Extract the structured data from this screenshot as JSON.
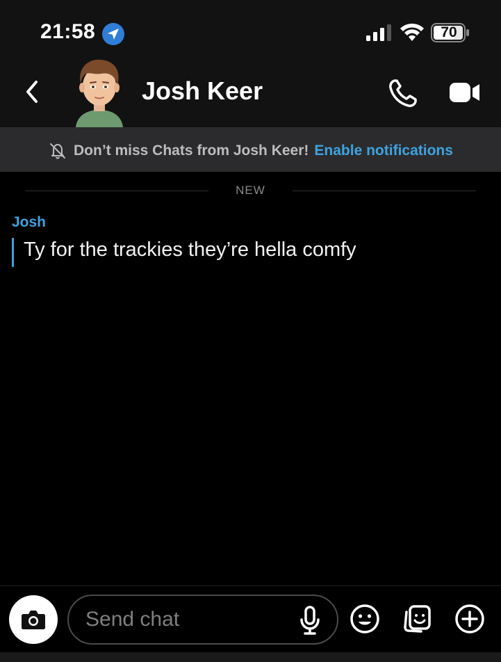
{
  "status_bar": {
    "time": "21:58",
    "battery": "70"
  },
  "header": {
    "contact_name": "Josh Keer",
    "icons": [
      "back-icon",
      "call-icon",
      "video-icon"
    ]
  },
  "notification_banner": {
    "text": "Don’t miss Chats from Josh Keer!",
    "link": "Enable notifications"
  },
  "conversation": {
    "divider_label": "NEW",
    "messages": [
      {
        "sender": "Josh",
        "text": "Ty for the trackies they’re hella comfy"
      }
    ]
  },
  "composer": {
    "placeholder": "Send chat",
    "icons": [
      "camera-icon",
      "microphone-icon",
      "emoji-icon",
      "sticker-icon",
      "plus-icon"
    ]
  },
  "colors": {
    "accent": "#3ea3e0",
    "header_bg": "#121212",
    "banner_bg": "#2b2b2d",
    "background": "#000000"
  }
}
